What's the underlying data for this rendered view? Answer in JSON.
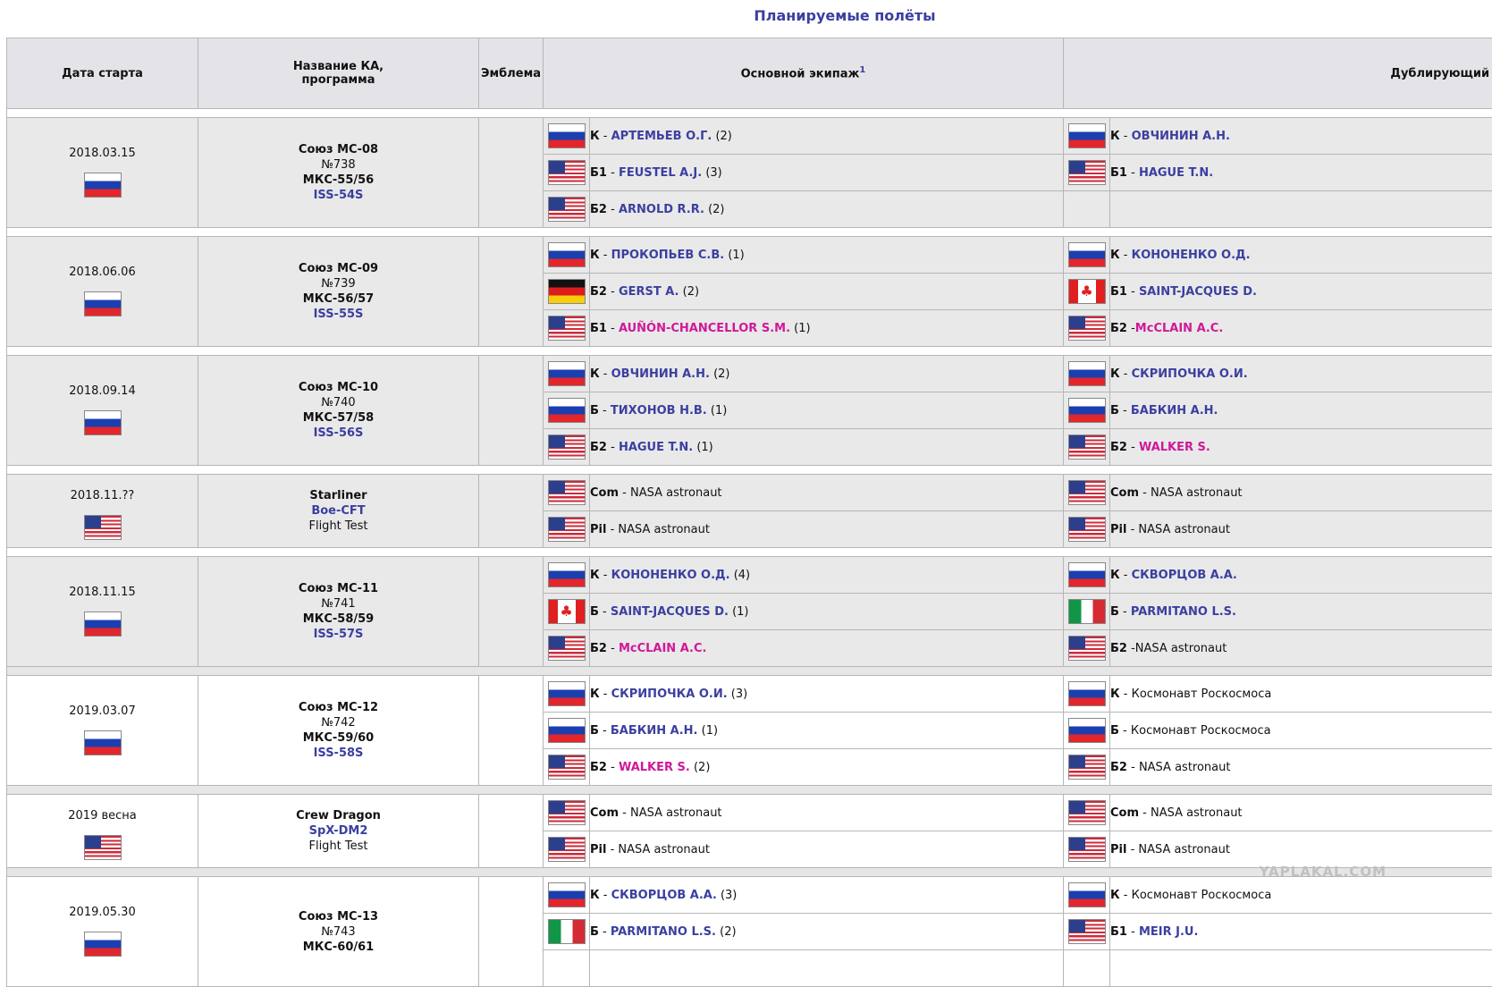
{
  "title": "Планируемые полёты",
  "headers": {
    "date": "Дата старта",
    "craft_line1": "Название КА,",
    "craft_line2": "программа",
    "emblem": "Эмблема",
    "prime": "Основной экипаж",
    "prime_note": "1",
    "backup": "Дублирующий экипаж"
  },
  "watermark": "YAPLAKAL.COM",
  "flights": [
    {
      "date": "2018.03.15",
      "flag": "ru-flag-icon",
      "craft": [
        "Союз МС-08",
        "№738",
        "МКС-55/56",
        "ISS-54S"
      ],
      "prime": [
        {
          "flag": "ru-flag-icon",
          "role": "К",
          "sep": " - ",
          "name": "АРТЕМЬЕВ О.Г.",
          "style": "lnk",
          "count": "(2)"
        },
        {
          "flag": "us-flag-icon",
          "role": "Б1",
          "sep": " - ",
          "name": "FEUSTEL A.J.",
          "style": "lnk",
          "count": "(3)"
        },
        {
          "flag": "us-flag-icon",
          "role": "Б2",
          "sep": " - ",
          "name": "ARNOLD R.R.",
          "style": "lnk",
          "count": "(2)"
        }
      ],
      "backup": [
        {
          "flag": "ru-flag-icon",
          "role": "К",
          "sep": " - ",
          "name": "ОВЧИНИН А.Н.",
          "style": "lnk",
          "count": ""
        },
        {
          "flag": "us-flag-icon",
          "role": "Б1",
          "sep": " - ",
          "name": "HAGUE T.N.",
          "style": "lnk",
          "count": ""
        },
        {
          "flag": "",
          "role": "",
          "sep": "",
          "name": "",
          "style": "",
          "count": ""
        }
      ]
    },
    {
      "date": "2018.06.06",
      "flag": "ru-flag-icon",
      "craft": [
        "Союз МС-09",
        "№739",
        "МКС-56/57",
        "ISS-55S"
      ],
      "prime": [
        {
          "flag": "ru-flag-icon",
          "role": "К",
          "sep": " - ",
          "name": "ПРОКОПЬЕВ С.В.",
          "style": "lnk",
          "count": "(1)"
        },
        {
          "flag": "de-flag-icon",
          "role": "Б2",
          "sep": " - ",
          "name": "GERST A.",
          "style": "lnk",
          "count": "(2)"
        },
        {
          "flag": "us-flag-icon",
          "role": "Б1",
          "sep": " - ",
          "name": "AUÑÓN-CHANCELLOR S.M.",
          "style": "pink",
          "count": "(1)"
        }
      ],
      "backup": [
        {
          "flag": "ru-flag-icon",
          "role": "К",
          "sep": " - ",
          "name": "КОНОНЕНКО О.Д.",
          "style": "lnk",
          "count": ""
        },
        {
          "flag": "ca-flag-icon",
          "role": "Б1",
          "sep": " - ",
          "name": "SAINT-JACQUES D.",
          "style": "lnk",
          "count": ""
        },
        {
          "flag": "us-flag-icon",
          "role": "Б2",
          "sep": " -",
          "name": "McCLAIN A.C.",
          "style": "pink",
          "count": ""
        }
      ]
    },
    {
      "date": "2018.09.14",
      "flag": "ru-flag-icon",
      "craft": [
        "Союз МС-10",
        "№740",
        "МКС-57/58",
        "ISS-56S"
      ],
      "prime": [
        {
          "flag": "ru-flag-icon",
          "role": "К",
          "sep": " - ",
          "name": "ОВЧИНИН А.Н.",
          "style": "lnk",
          "count": "(2)"
        },
        {
          "flag": "ru-flag-icon",
          "role": "Б",
          "sep": " - ",
          "name": "ТИХОНОВ Н.В.",
          "style": "lnk",
          "count": "(1)"
        },
        {
          "flag": "us-flag-icon",
          "role": "Б2",
          "sep": " - ",
          "name": "HAGUE T.N.",
          "style": "lnk",
          "count": "(1)"
        }
      ],
      "backup": [
        {
          "flag": "ru-flag-icon",
          "role": "К",
          "sep": " - ",
          "name": "СКРИПОЧКА О.И.",
          "style": "lnk",
          "count": ""
        },
        {
          "flag": "ru-flag-icon",
          "role": "Б",
          "sep": " - ",
          "name": "БАБКИН А.Н.",
          "style": "lnk",
          "count": ""
        },
        {
          "flag": "us-flag-icon",
          "role": "Б2",
          "sep": " - ",
          "name": "WALKER S.",
          "style": "pink",
          "count": ""
        }
      ]
    },
    {
      "date": "2018.11.??",
      "flag": "us-flag-icon",
      "craft": [
        "Starliner",
        "Boe-CFT",
        "Flight Test"
      ],
      "prime": [
        {
          "flag": "us-flag-icon",
          "role": "Com",
          "sep": " - ",
          "name": "NASA astronaut",
          "style": "",
          "count": ""
        },
        {
          "flag": "us-flag-icon",
          "role": "Pil",
          "sep": " - ",
          "name": "NASA astronaut",
          "style": "",
          "count": ""
        }
      ],
      "backup": [
        {
          "flag": "us-flag-icon",
          "role": "Com",
          "sep": " - ",
          "name": "NASA astronaut",
          "style": "",
          "count": ""
        },
        {
          "flag": "us-flag-icon",
          "role": "Pil",
          "sep": " - ",
          "name": "NASA astronaut",
          "style": "",
          "count": ""
        }
      ]
    },
    {
      "date": "2018.11.15",
      "flag": "ru-flag-icon",
      "craft": [
        "Союз МС-11",
        "№741",
        "МКС-58/59",
        "ISS-57S"
      ],
      "prime": [
        {
          "flag": "ru-flag-icon",
          "role": "К",
          "sep": " - ",
          "name": "КОНОНЕНКО О.Д.",
          "style": "lnk",
          "count": "(4)"
        },
        {
          "flag": "ca-flag-icon",
          "role": "Б",
          "sep": " - ",
          "name": "SAINT-JACQUES D.",
          "style": "lnk",
          "count": "(1)"
        },
        {
          "flag": "us-flag-icon",
          "role": "Б2",
          "sep": " - ",
          "name": "McCLAIN A.C.",
          "style": "pink",
          "count": ""
        }
      ],
      "backup": [
        {
          "flag": "ru-flag-icon",
          "role": "К",
          "sep": " - ",
          "name": "СКВОРЦОВ А.А.",
          "style": "lnk",
          "count": ""
        },
        {
          "flag": "it-flag-icon",
          "role": "Б",
          "sep": " - ",
          "name": "PARMITANO L.S.",
          "style": "lnk",
          "count": ""
        },
        {
          "flag": "us-flag-icon",
          "role": "Б2",
          "sep": " -",
          "name": "NASA astronaut",
          "style": "",
          "count": ""
        }
      ]
    },
    {
      "date": "2019.03.07",
      "flag": "ru-flag-icon",
      "white": true,
      "craft": [
        "Союз МС-12",
        "№742",
        "МКС-59/60",
        "ISS-58S"
      ],
      "prime": [
        {
          "flag": "ru-flag-icon",
          "role": "К",
          "sep": " - ",
          "name": "СКРИПОЧКА О.И.",
          "style": "lnk",
          "count": "(3)"
        },
        {
          "flag": "ru-flag-icon",
          "role": "Б",
          "sep": " - ",
          "name": "БАБКИН А.Н.",
          "style": "lnk",
          "count": "(1)"
        },
        {
          "flag": "us-flag-icon",
          "role": "Б2",
          "sep": " - ",
          "name": "WALKER S.",
          "style": "pink",
          "count": "(2)"
        }
      ],
      "backup": [
        {
          "flag": "ru-flag-icon",
          "role": "К",
          "sep": " - ",
          "name": "Космонавт Роскосмоса",
          "style": "",
          "count": ""
        },
        {
          "flag": "ru-flag-icon",
          "role": "Б",
          "sep": " - ",
          "name": "Космонавт Роскосмоса",
          "style": "",
          "count": ""
        },
        {
          "flag": "us-flag-icon",
          "role": "Б2",
          "sep": " - ",
          "name": "NASA astronaut",
          "style": "",
          "count": ""
        }
      ]
    },
    {
      "date": "2019 весна",
      "flag": "us-flag-icon",
      "white": true,
      "craft": [
        "Crew Dragon",
        "SpX-DM2",
        "Flight Test"
      ],
      "prime": [
        {
          "flag": "us-flag-icon",
          "role": "Com",
          "sep": " - ",
          "name": "NASA astronaut",
          "style": "",
          "count": ""
        },
        {
          "flag": "us-flag-icon",
          "role": "Pil",
          "sep": " - ",
          "name": "NASA astronaut",
          "style": "",
          "count": ""
        }
      ],
      "backup": [
        {
          "flag": "us-flag-icon",
          "role": "Com",
          "sep": " - ",
          "name": "NASA astronaut",
          "style": "",
          "count": ""
        },
        {
          "flag": "us-flag-icon",
          "role": "Pil",
          "sep": " - ",
          "name": "NASA astronaut",
          "style": "",
          "count": ""
        }
      ]
    },
    {
      "date": "2019.05.30",
      "flag": "ru-flag-icon",
      "white": true,
      "craft": [
        "Союз МС-13",
        "№743",
        "МКС-60/61",
        ""
      ],
      "prime": [
        {
          "flag": "ru-flag-icon",
          "role": "К",
          "sep": " - ",
          "name": "СКВОРЦОВ А.А.",
          "style": "lnk",
          "count": "(3)"
        },
        {
          "flag": "it-flag-icon",
          "role": "Б",
          "sep": " - ",
          "name": "PARMITANO L.S.",
          "style": "lnk",
          "count": "(2)"
        },
        {
          "flag": "",
          "role": "",
          "sep": "",
          "name": "",
          "style": "",
          "count": ""
        }
      ],
      "backup": [
        {
          "flag": "ru-flag-icon",
          "role": "К",
          "sep": " - ",
          "name": "Космонавт Роскосмоса",
          "style": "",
          "count": ""
        },
        {
          "flag": "us-flag-icon",
          "role": "Б1",
          "sep": " - ",
          "name": "MEIR J.U.",
          "style": "lnk",
          "count": ""
        },
        {
          "flag": "",
          "role": "",
          "sep": "",
          "name": "",
          "style": "",
          "count": ""
        }
      ]
    }
  ]
}
